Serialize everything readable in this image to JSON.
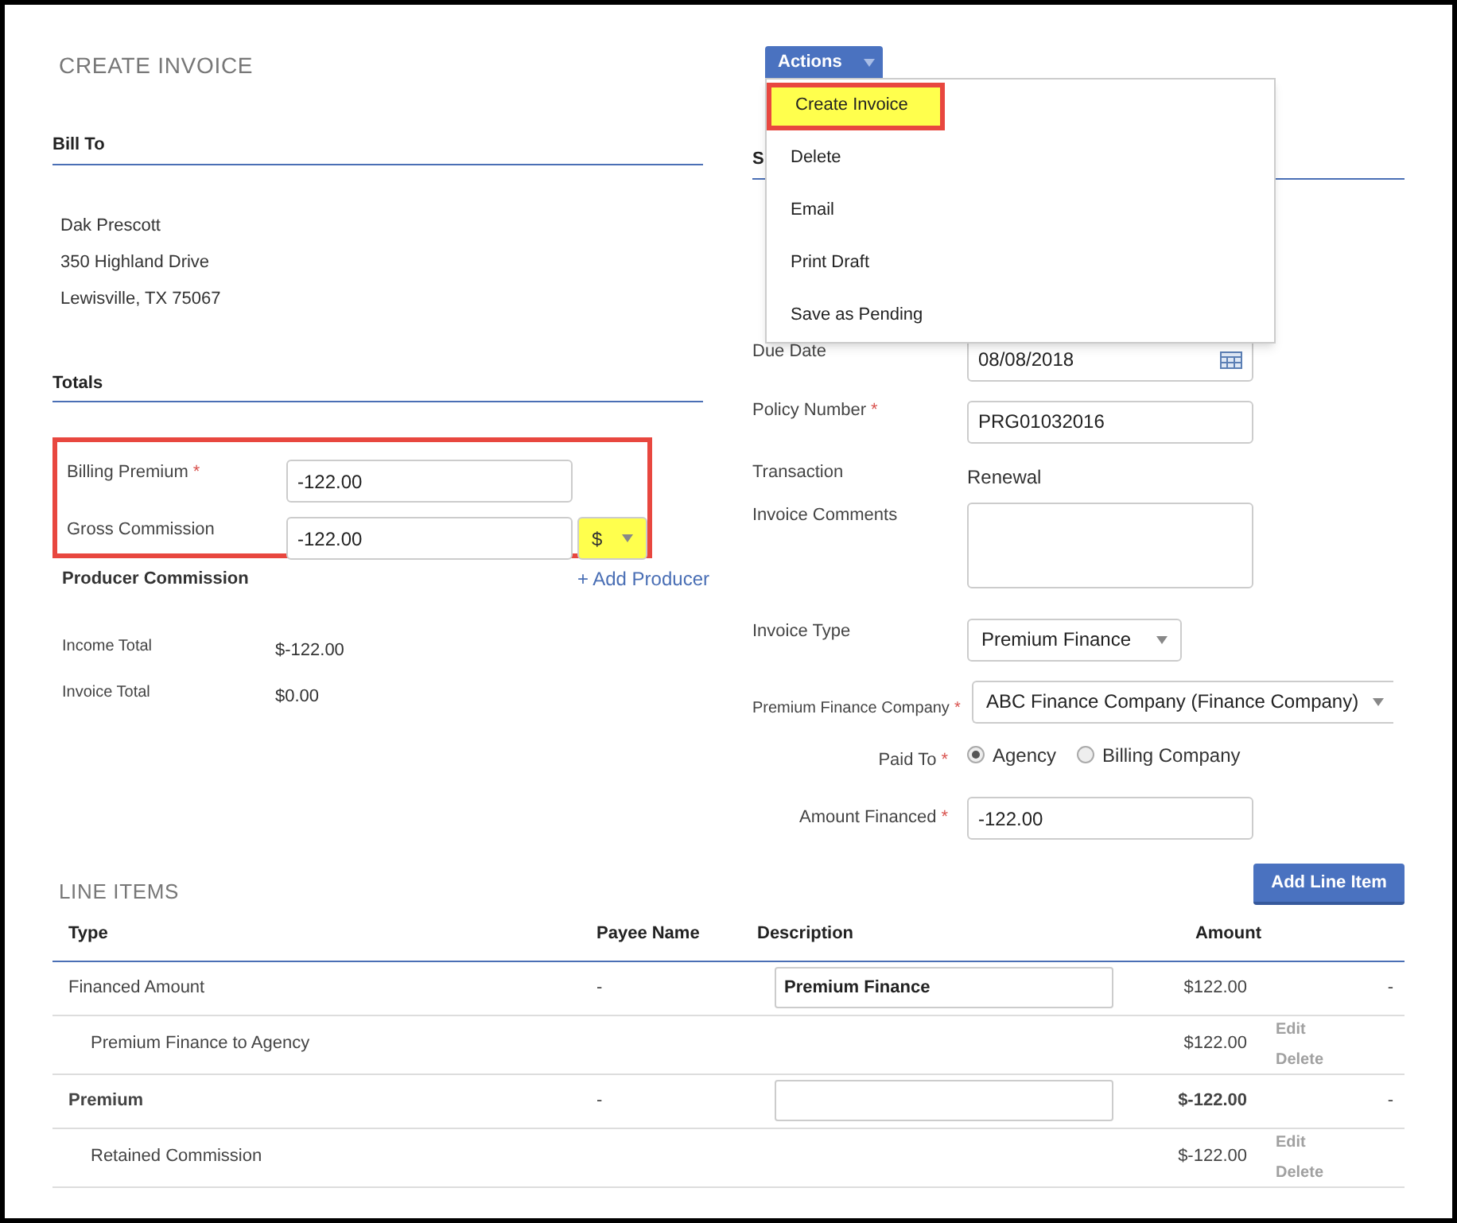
{
  "title": "CREATE INVOICE",
  "actions": {
    "label": "Actions",
    "items": [
      {
        "label": "Create Invoice",
        "highlighted": true
      },
      {
        "label": "Delete",
        "highlighted": false
      },
      {
        "label": "Email",
        "highlighted": false
      },
      {
        "label": "Print Draft",
        "highlighted": false
      },
      {
        "label": "Save as Pending",
        "highlighted": false
      }
    ]
  },
  "bill_to": {
    "heading": "Bill To",
    "lines": [
      "Dak Prescott",
      "350 Highland Drive",
      "Lewisville, TX 75067"
    ]
  },
  "totals": {
    "heading": "Totals",
    "highlighted": true,
    "billing_premium": {
      "label": "Billing Premium",
      "required_mark": "*",
      "value": "-122.00"
    },
    "gross_commission": {
      "label": "Gross Commission",
      "value": "-122.00",
      "unit": "$",
      "unit_highlighted": true
    },
    "producer_commission": "Producer Commission",
    "add_producer": "+ Add Producer",
    "summary": [
      {
        "label": "Income Total",
        "value": "$-122.00"
      },
      {
        "label": "Invoice Total",
        "value": "$0.00"
      }
    ]
  },
  "right": {
    "heading": "S",
    "due_date": {
      "label": "Due Date",
      "value": "08/08/2018"
    },
    "policy_number": {
      "label": "Policy Number",
      "required_mark": "*",
      "value": "PRG01032016"
    },
    "transaction": {
      "label": "Transaction",
      "value": "Renewal"
    },
    "invoice_comments": {
      "label": "Invoice Comments"
    },
    "invoice_type": {
      "label": "Invoice Type",
      "value": "Premium Finance"
    },
    "finance_company": {
      "label": "Premium Finance Company",
      "required_mark": "*",
      "value": "ABC Finance Company (Finance Company)"
    },
    "paid_to": {
      "label": "Paid To",
      "required_mark": "*",
      "options": [
        {
          "label": "Agency",
          "selected": true
        },
        {
          "label": "Billing Company",
          "selected": false
        }
      ]
    },
    "amount_financed": {
      "label": "Amount Financed",
      "required_mark": "*",
      "value": "-122.00"
    }
  },
  "line_items": {
    "heading": "LINE ITEMS",
    "add_button": "Add Line Item",
    "columns": [
      "Type",
      "Payee Name",
      "Description",
      "Amount"
    ],
    "rows": [
      {
        "kind": "main",
        "bold": false,
        "type": "Financed Amount",
        "payee": "-",
        "description": "Premium Finance",
        "amount": "$122.00",
        "end": "-"
      },
      {
        "kind": "sub",
        "type": "Premium Finance to Agency",
        "amount": "$122.00",
        "edit": "Edit",
        "delete": "Delete",
        "disabled": true
      },
      {
        "kind": "main",
        "bold": true,
        "type": "Premium",
        "payee": "-",
        "amount": "$-122.00",
        "end": "-"
      },
      {
        "kind": "sub",
        "type": "Retained Commission",
        "amount": "$-122.00",
        "edit": "Edit",
        "delete": "Delete",
        "disabled": true
      }
    ]
  }
}
